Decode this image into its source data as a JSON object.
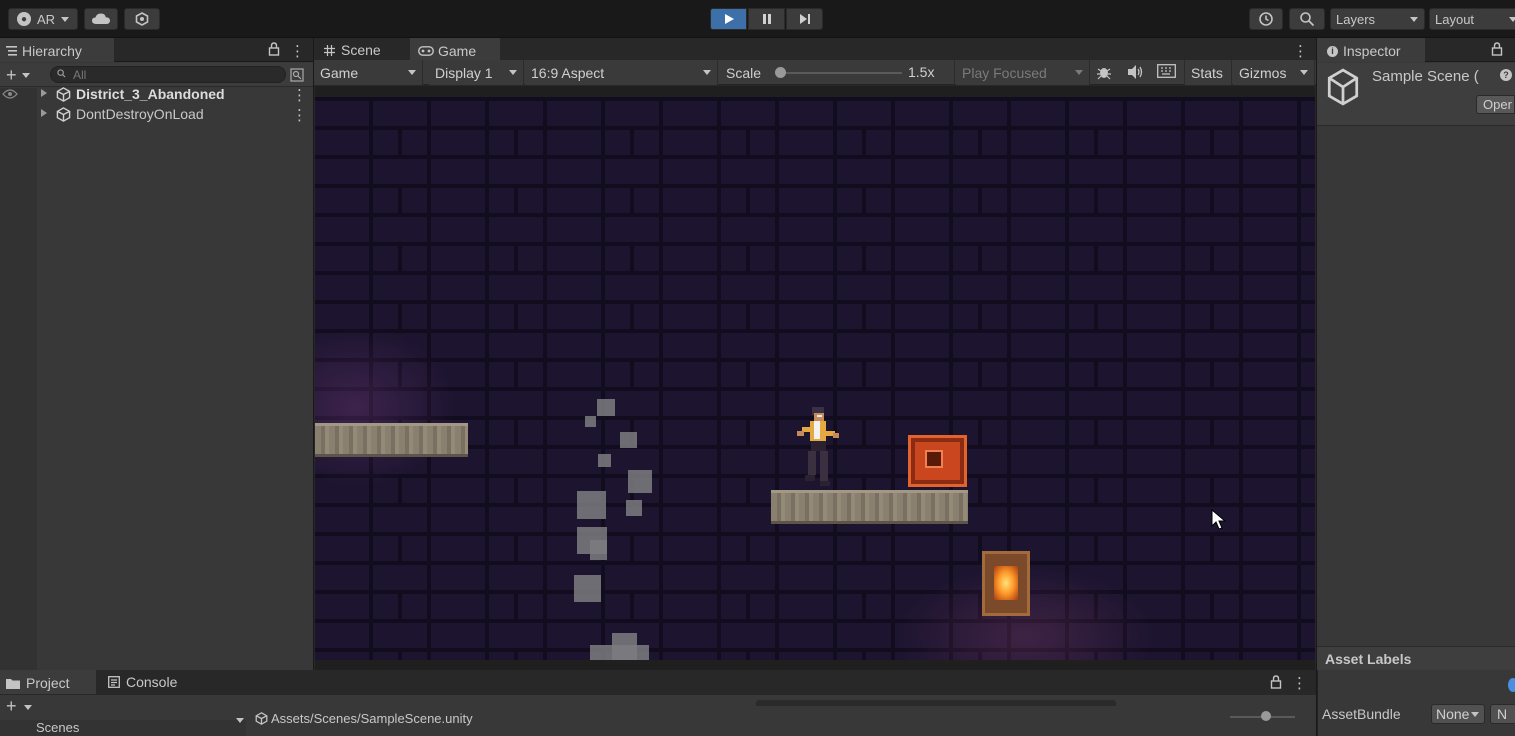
{
  "toolbar": {
    "account_label": "AR",
    "layers_label": "Layers",
    "layout_label": "Layout",
    "play_state": "playing"
  },
  "hierarchy": {
    "tab_label": "Hierarchy",
    "search_placeholder": "All",
    "items": [
      {
        "label": "District_3_Abandoned",
        "bold": true
      },
      {
        "label": "DontDestroyOnLoad",
        "bold": false
      }
    ]
  },
  "center_tabs": {
    "scene_label": "Scene",
    "game_label": "Game"
  },
  "game_toolbar": {
    "mode": "Game",
    "display": "Display 1",
    "aspect": "16:9 Aspect",
    "scale_label": "Scale",
    "scale_value": "1.5x",
    "play_mode": "Play Focused",
    "stats_label": "Stats",
    "gizmos_label": "Gizmos"
  },
  "inspector": {
    "tab_label": "Inspector",
    "title": "Sample Scene (",
    "open_label": "Oper",
    "asset_labels_header": "Asset Labels",
    "assetbundle_label": "AssetBundle",
    "assetbundle_value": "None",
    "variant_value": "N"
  },
  "bottom": {
    "project_tab": "Project",
    "console_tab": "Console",
    "path": "Assets/Scenes/SampleScene.unity",
    "folder": "Scenes"
  },
  "colors": {
    "play_active": "#3d6fa8",
    "panel_bg": "#383838",
    "toolbar_bg": "#191919",
    "game_bg": "#1d1530"
  }
}
